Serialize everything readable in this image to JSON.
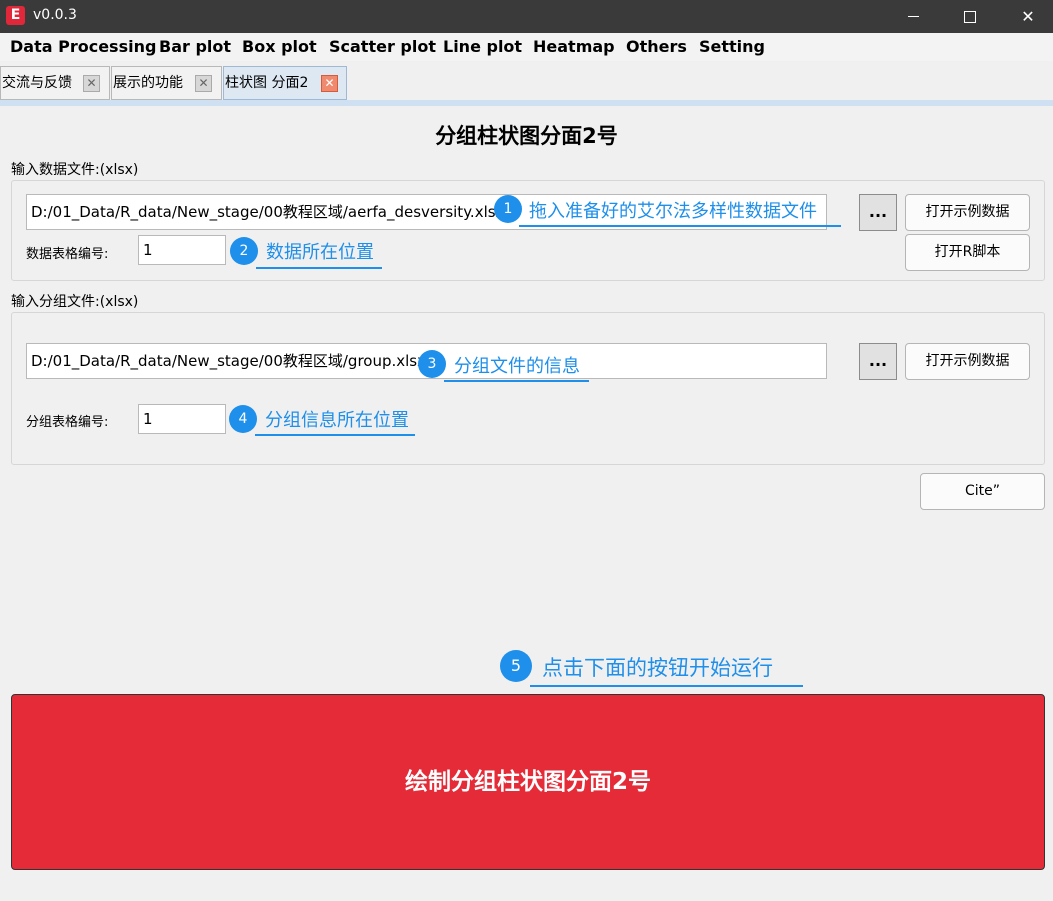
{
  "window": {
    "title": "v0.0.3",
    "icon_letter": "E"
  },
  "menu": [
    "Data Processing",
    "Bar plot",
    "Box plot",
    "Scatter plot",
    "Line plot",
    "Heatmap",
    "Others",
    "Setting"
  ],
  "tabs": [
    {
      "label": "交流与反馈",
      "active": false
    },
    {
      "label": "展示的功能",
      "active": false
    },
    {
      "label": "柱状图 分面2",
      "active": true
    }
  ],
  "page": {
    "title": "分组柱状图分面2号"
  },
  "data_file": {
    "section_label": "输入数据文件:(xlsx)",
    "path": "D:/01_Data/R_data/New_stage/00教程区域/aerfa_desversity.xlsx",
    "browse_label": "...",
    "sheet_label": "数据表格编号:",
    "sheet_value": "1",
    "open_example_label": "打开示例数据",
    "open_r_script_label": "打开R脚本"
  },
  "group_file": {
    "section_label": "输入分组文件:(xlsx)",
    "path": "D:/01_Data/R_data/New_stage/00教程区域/group.xlsx",
    "browse_label": "...",
    "sheet_label": "分组表格编号:",
    "sheet_value": "1",
    "open_example_label": "打开示例数据"
  },
  "cite_label": "Cite”",
  "annotations": [
    {
      "number": "1",
      "text": "拖入准备好的艾尔法多样性数据文件"
    },
    {
      "number": "2",
      "text": "数据所在位置"
    },
    {
      "number": "3",
      "text": "分组文件的信息"
    },
    {
      "number": "4",
      "text": "分组信息所在位置"
    },
    {
      "number": "5",
      "text": "点击下面的按钮开始运行"
    }
  ],
  "run_button_label": "绘制分组柱状图分面2号",
  "colors": {
    "titlebar": "#3a3a3a",
    "run_button": "#e52b38",
    "annotation": "#1e8fea",
    "active_tab": "#dde8f3"
  },
  "icons": {
    "minimize": "minimize-icon",
    "maximize": "maximize-icon",
    "close": "close-icon",
    "tab_close": "tab-close-icon"
  }
}
